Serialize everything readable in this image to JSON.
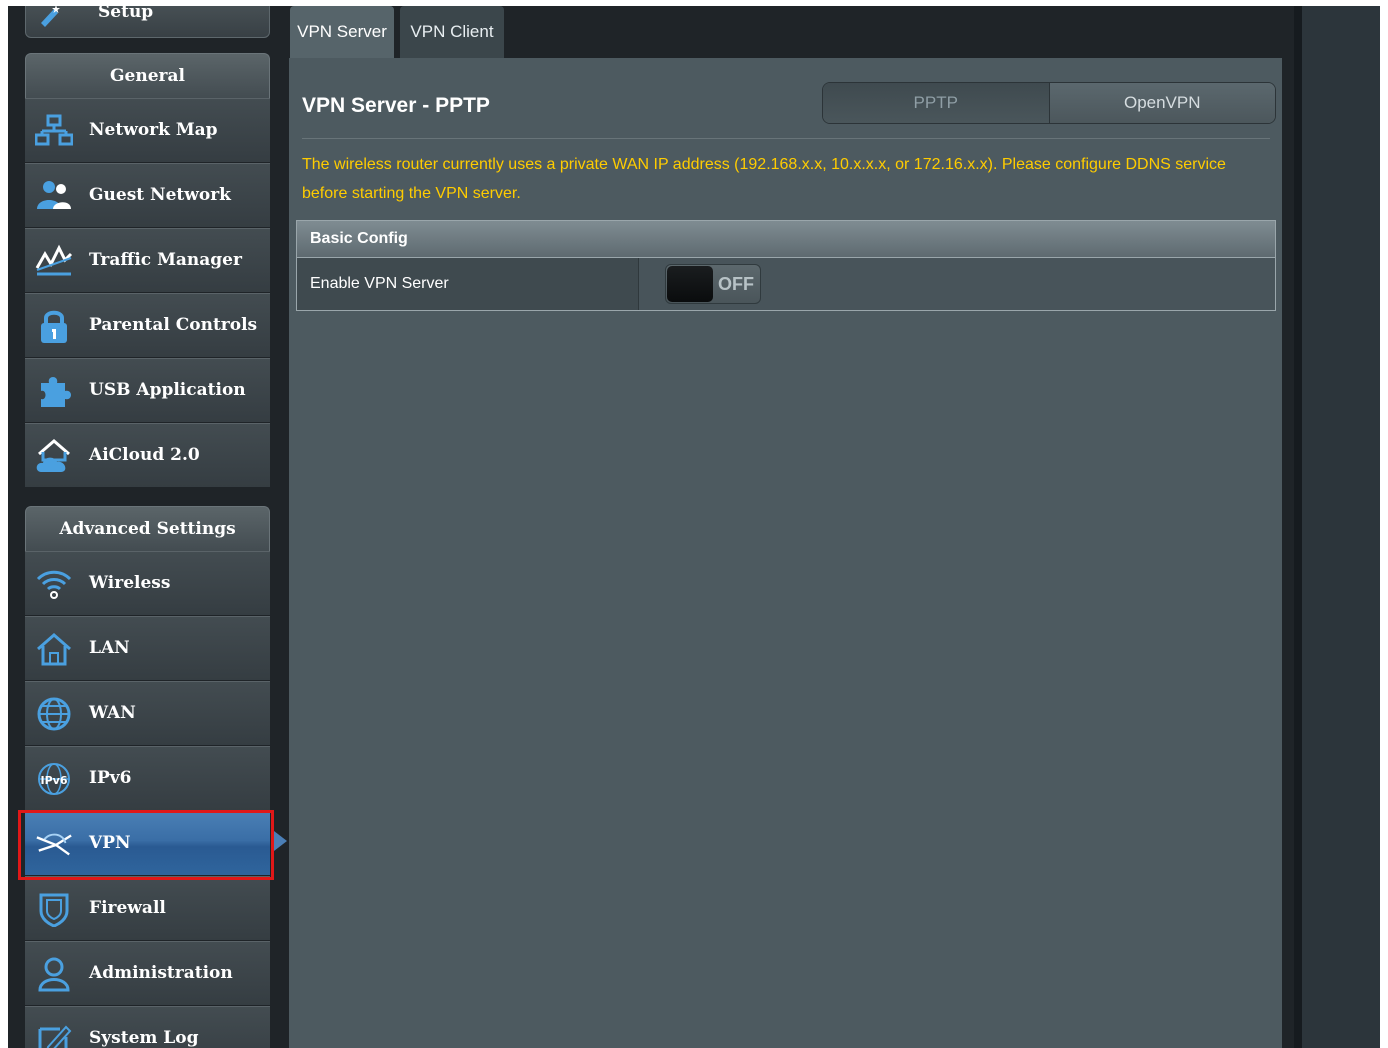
{
  "sidebar": {
    "setup_label": "Setup",
    "general_header": "General",
    "general_items": [
      {
        "label": "Network Map",
        "icon": "network-map-icon"
      },
      {
        "label": "Guest Network",
        "icon": "guest-network-icon"
      },
      {
        "label": "Traffic Manager",
        "icon": "traffic-manager-icon"
      },
      {
        "label": "Parental Controls",
        "icon": "parental-controls-icon"
      },
      {
        "label": "USB Application",
        "icon": "usb-application-icon"
      },
      {
        "label": "AiCloud 2.0",
        "icon": "aicloud-icon"
      }
    ],
    "advanced_header": "Advanced Settings",
    "advanced_items": [
      {
        "label": "Wireless",
        "icon": "wifi-icon"
      },
      {
        "label": "LAN",
        "icon": "home-icon"
      },
      {
        "label": "WAN",
        "icon": "globe-icon"
      },
      {
        "label": "IPv6",
        "icon": "ipv6-globe-icon"
      },
      {
        "label": "VPN",
        "icon": "vpn-icon"
      },
      {
        "label": "Firewall",
        "icon": "shield-icon"
      },
      {
        "label": "Administration",
        "icon": "user-icon"
      },
      {
        "label": "System Log",
        "icon": "edit-log-icon"
      }
    ],
    "active_item": "VPN"
  },
  "tabs": [
    {
      "label": "VPN Server"
    },
    {
      "label": "VPN Client"
    }
  ],
  "main": {
    "title": "VPN Server - PPTP",
    "protocol_options": [
      "PPTP",
      "OpenVPN"
    ],
    "selected_protocol": "PPTP",
    "warning": "The wireless router currently uses a private WAN IP address (192.168.x.x, 10.x.x.x, or 172.16.x.x). Please configure DDNS service before starting the VPN server.",
    "config": {
      "header": "Basic Config",
      "rows": [
        {
          "label": "Enable VPN Server",
          "toggle_state": "OFF"
        }
      ]
    }
  },
  "colors": {
    "warning_text": "#ffcc00",
    "active_nav": "#3a6ea6",
    "highlight_outline": "#e01818",
    "panel_bg": "#4d5a60"
  }
}
